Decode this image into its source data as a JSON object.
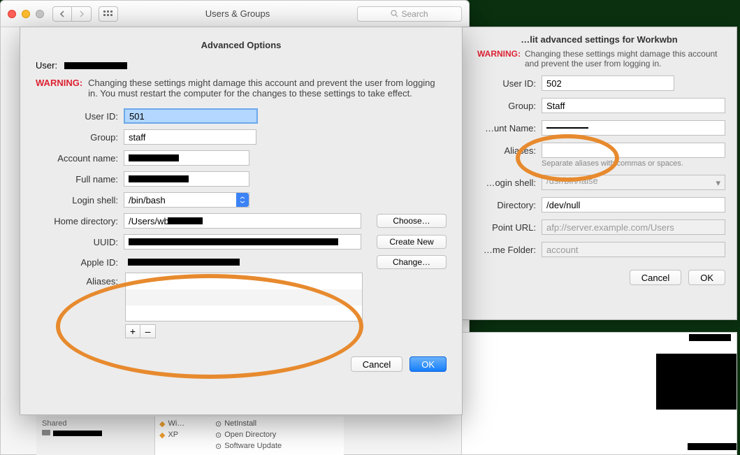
{
  "bg": {
    "title": "Users & Groups",
    "search_placeholder": "Search",
    "peek": {
      "shared": "Shared",
      "vm1": "Wi…",
      "vm2": "XP",
      "svc1": "NetInstall",
      "svc2": "Open Directory",
      "svc3": "Software Update"
    }
  },
  "right": {
    "title": "…lit advanced settings for Workwbn",
    "warn_label": "WARNING:",
    "warn_text": "Changing these settings might damage this account and prevent the user from logging in.",
    "user_id_label": "User ID:",
    "user_id": "502",
    "group_label": "Group:",
    "group": "Staff",
    "acct_label": "…unt Name:",
    "aliases_label": "Aliases:",
    "aliases_hint": "Separate aliases with commas or spaces.",
    "shell_label": "…ogin shell:",
    "shell": "/usr/bin/false",
    "dir_label": "Directory:",
    "dir": "/dev/null",
    "point_label": "Point URL:",
    "point": "afp://server.example.com/Users",
    "folder_label": "…me Folder:",
    "folder": "account",
    "cancel": "Cancel",
    "ok": "OK"
  },
  "modal": {
    "title": "Advanced Options",
    "user_label": "User:",
    "warn_label": "WARNING:",
    "warn_text": "Changing these settings might damage this account and prevent the user from logging in. You must restart the computer for the changes to these settings to take effect.",
    "user_id_label": "User ID:",
    "user_id": "501",
    "group_label": "Group:",
    "group": "staff",
    "acct_label": "Account name:",
    "full_label": "Full name:",
    "shell_label": "Login shell:",
    "shell": "/bin/bash",
    "home_label": "Home directory:",
    "home": "/Users/wb",
    "uuid_label": "UUID:",
    "apple_label": "Apple ID:",
    "aliases_label": "Aliases:",
    "choose": "Choose…",
    "create": "Create New",
    "change": "Change…",
    "plus": "+",
    "minus": "–",
    "cancel": "Cancel",
    "ok": "OK"
  }
}
